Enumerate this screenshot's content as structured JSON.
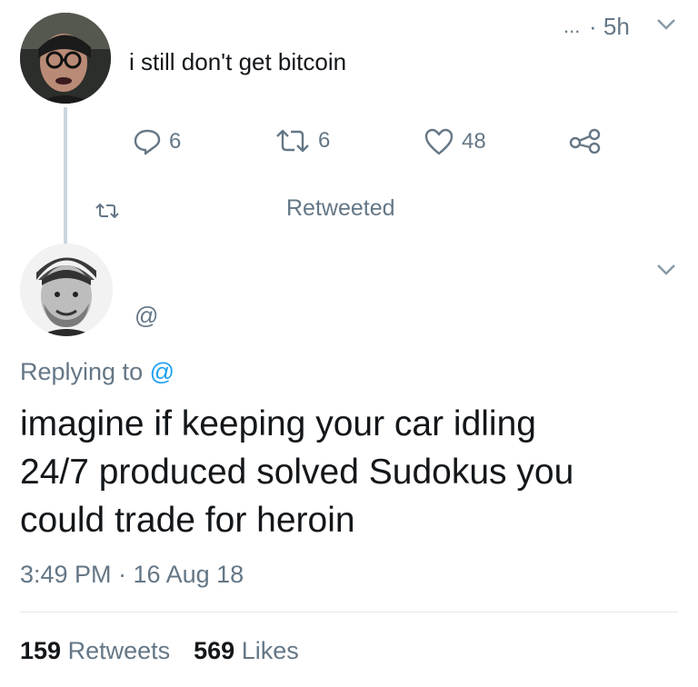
{
  "tweet1": {
    "menu_dots": "...",
    "time": "· 5h",
    "text": "i still don't get bitcoin",
    "replies": "6",
    "retweets": "6",
    "likes": "48"
  },
  "retweet_row": {
    "label": "Retweeted"
  },
  "tweet2": {
    "handle": "@",
    "replying_prefix": "Replying to ",
    "replying_handle": "@",
    "text_lines": [
      "imagine if keeping your car idling",
      "24/7 produced solved Sudokus you",
      "could trade for heroin"
    ],
    "timestamp": "3:49 PM · 16 Aug 18",
    "stats": {
      "retweets_count": "159",
      "retweets_label": "Retweets",
      "likes_count": "569",
      "likes_label": "Likes"
    }
  },
  "colors": {
    "muted": "#657786",
    "link": "#1da1f2",
    "text": "#14171a"
  }
}
